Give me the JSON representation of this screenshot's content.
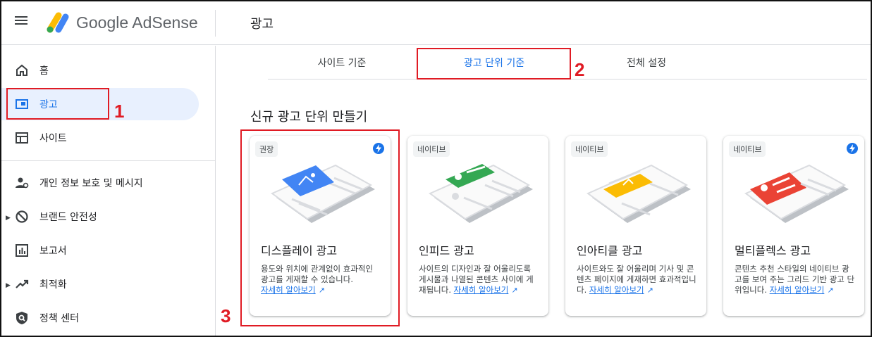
{
  "header": {
    "brand": "Google AdSense",
    "title": "광고"
  },
  "sidebar": {
    "items": [
      {
        "label": "홈",
        "icon": "home-icon"
      },
      {
        "label": "광고",
        "icon": "ads-icon",
        "active": true
      },
      {
        "label": "사이트",
        "icon": "sites-icon"
      },
      {
        "label": "개인 정보 보호 및 메시지",
        "icon": "privacy-messaging-icon"
      },
      {
        "label": "브랜드 안전성",
        "icon": "brand-safety-icon"
      },
      {
        "label": "보고서",
        "icon": "reports-icon"
      },
      {
        "label": "최적화",
        "icon": "optimization-icon"
      },
      {
        "label": "정책 센터",
        "icon": "policy-center-icon"
      }
    ]
  },
  "tabs": [
    {
      "label": "사이트 기준"
    },
    {
      "label": "광고 단위 기준",
      "active": true
    },
    {
      "label": "전체 설정"
    }
  ],
  "section_title": "신규 광고 단위 만들기",
  "cards": [
    {
      "chip": "권장",
      "title": "디스플레이 광고",
      "desc": "용도와 위치에 관계없이 효과적인 광고를 게재할 수 있습니다.",
      "link": "자세히 알아보기",
      "accent": "#4285f4",
      "bolt": true
    },
    {
      "chip": "네이티브",
      "title": "인피드 광고",
      "desc": "사이트의 디자인과 잘 어울리도록 게시물과 나열된 콘텐츠 사이에 게재됩니다.",
      "link": "자세히 알아보기",
      "accent": "#34a853",
      "bolt": false
    },
    {
      "chip": "네이티브",
      "title": "인아티클 광고",
      "desc": "사이트와도 잘 어울리며 기사 및 콘텐츠 페이지에 게재하면 효과적입니다.",
      "link": "자세히 알아보기",
      "accent": "#fbbc04",
      "bolt": false
    },
    {
      "chip": "네이티브",
      "title": "멀티플렉스 광고",
      "desc": "콘텐츠 추천 스타일의 네이티브 광고를 보여 주는 그리드 기반 광고 단위입니다.",
      "link": "자세히 알아보기",
      "accent": "#ea4335",
      "bolt": true
    }
  ],
  "annotations": [
    "1",
    "2",
    "3"
  ],
  "colors": {
    "accent": "#1a73e8",
    "annotation": "#e01b24",
    "active_bg": "#e8f0fe"
  }
}
